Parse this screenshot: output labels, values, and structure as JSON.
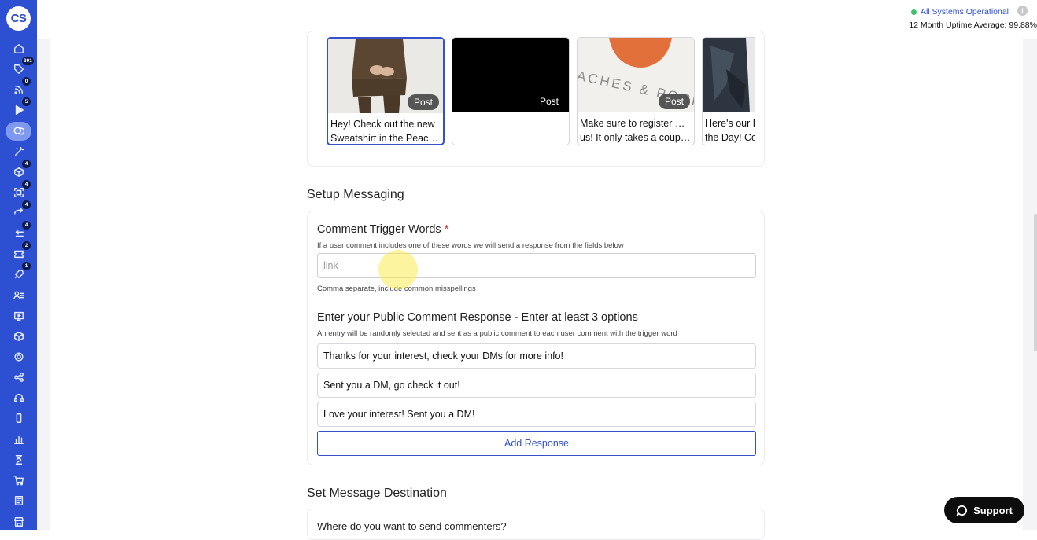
{
  "logo": {
    "text": "CS"
  },
  "sidebar": {
    "items": [
      {
        "icon": "home-icon",
        "badge": ""
      },
      {
        "icon": "tag-icon",
        "badge": "301"
      },
      {
        "icon": "rss-icon",
        "badge": "0"
      },
      {
        "icon": "play-icon",
        "badge": "5"
      },
      {
        "icon": "chat-bubbles-icon",
        "badge": ""
      },
      {
        "icon": "magic-wand-icon",
        "badge": ""
      },
      {
        "icon": "box-icon",
        "badge": "4"
      },
      {
        "icon": "scan-icon",
        "badge": "4"
      },
      {
        "icon": "forward-arrow-icon",
        "badge": "4"
      },
      {
        "icon": "return-arrow-icon",
        "badge": "4"
      },
      {
        "icon": "ticket-icon",
        "badge": "2"
      },
      {
        "icon": "rocket-icon",
        "badge": "1"
      },
      {
        "icon": "user-list-icon",
        "badge": ""
      },
      {
        "icon": "video-icon",
        "badge": ""
      },
      {
        "icon": "package-icon",
        "badge": ""
      },
      {
        "icon": "gear-icon",
        "badge": ""
      },
      {
        "icon": "share-icon",
        "badge": ""
      },
      {
        "icon": "headset-icon",
        "badge": ""
      },
      {
        "icon": "mobile-icon",
        "badge": ""
      },
      {
        "icon": "bar-chart-icon",
        "badge": ""
      },
      {
        "icon": "hourglass-icon",
        "badge": ""
      },
      {
        "icon": "cart-icon",
        "badge": ""
      },
      {
        "icon": "document-icon",
        "badge": ""
      },
      {
        "icon": "store-icon",
        "badge": ""
      }
    ]
  },
  "status": {
    "text": "All Systems Operational",
    "uptime": "12 Month Uptime Average: 99.88%",
    "color": "#3fbf6f"
  },
  "posts": [
    {
      "tag": "Post",
      "line1": "Hey! Check out the new",
      "line2": "Sweatshirt in the Peach…"
    },
    {
      "tag": "Post",
      "line1": "",
      "line2": ""
    },
    {
      "tag": "Post",
      "line1": "Make sure to register with",
      "line2": "us! It only takes a coupl…",
      "image_text": "ACHES & POCK"
    },
    {
      "tag": "",
      "line1": "Here's our P",
      "line2": "the Day! Co"
    }
  ],
  "setup": {
    "title": "Setup Messaging",
    "trigger_label": "Comment Trigger Words",
    "required_mark": "*",
    "trigger_help": "If a user comment includes one of these words we will send a response from the fields below",
    "trigger_placeholder": "link",
    "trigger_hint": "Comma separate, include common misspellings",
    "response_label": "Enter your Public Comment Response - Enter at least 3 options",
    "response_help": "An entry will be randomly selected and sent as a public comment to each user comment with the trigger word",
    "responses": [
      "Thanks for your interest, check your DMs for more info!",
      "Sent you a DM, go check it out!",
      "Love your interest! Sent you a DM!"
    ],
    "add_button": "Add Response"
  },
  "destination": {
    "title": "Set Message Destination",
    "question": "Where do you want to send commenters?"
  },
  "support": {
    "label": "Support"
  },
  "colors": {
    "sidebar": "#2d4fd1",
    "accent": "#3550c9"
  }
}
